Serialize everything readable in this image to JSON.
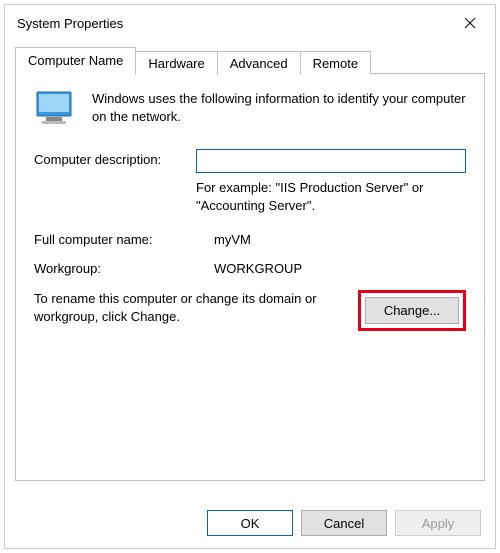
{
  "window": {
    "title": "System Properties"
  },
  "tabs": {
    "computer_name": "Computer Name",
    "hardware": "Hardware",
    "advanced": "Advanced",
    "remote": "Remote"
  },
  "panel": {
    "intro": "Windows uses the following information to identify your computer on the network.",
    "description_label": "Computer description:",
    "description_value": "",
    "description_hint": "For example: \"IIS Production Server\" or \"Accounting Server\".",
    "fullname_label": "Full computer name:",
    "fullname_value": "myVM",
    "workgroup_label": "Workgroup:",
    "workgroup_value": "WORKGROUP",
    "rename_text": "To rename this computer or change its domain or workgroup, click Change.",
    "change_button": "Change..."
  },
  "footer": {
    "ok": "OK",
    "cancel": "Cancel",
    "apply": "Apply"
  }
}
